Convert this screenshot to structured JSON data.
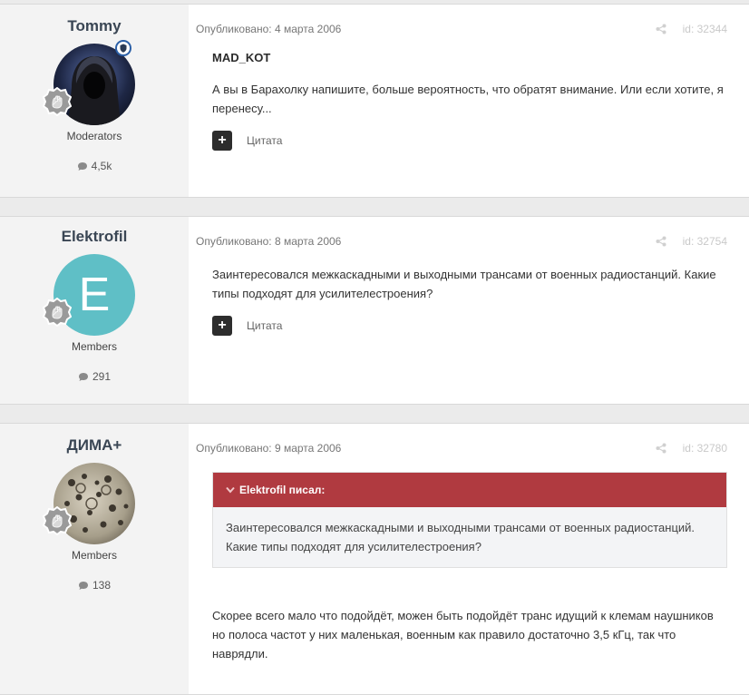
{
  "quote_label": "Цитата",
  "posts": [
    {
      "author": "Tommy",
      "group": "Moderators",
      "post_count": "4,5k",
      "date": "Опубликовано: 4 марта 2006",
      "post_id": "id: 32344",
      "addressee": "MAD_KOT",
      "body": "А вы в Барахолку напишите, больше вероятность, что обратят внимание. Или если хотите, я перенесу..."
    },
    {
      "author": "Elektrofil",
      "group": "Members",
      "post_count": "291",
      "avatar_letter": "E",
      "date": "Опубликовано: 8 марта 2006",
      "post_id": "id: 32754",
      "body": "Заинтересовался межкаскадными и выходными трансами от военных радиостанций. Какие типы подходят для усилителестроения?"
    },
    {
      "author": "ДИМА+",
      "group": "Members",
      "post_count": "138",
      "date": "Опубликовано: 9 марта 2006",
      "post_id": "id: 32780",
      "quote": {
        "header": "Elektrofil писал:",
        "text": "Заинтересовался межкаскадными и выходными трансами от военных радиостанций. Какие типы подходят для усилителестроения?"
      },
      "body": "Скорее всего мало что подойдёт, можен быть подойдёт транс идущий к клемам наушников но полоса частот у них маленькая, военным как правило достаточно 3,5 кГц, так что наврядли."
    }
  ],
  "colors": {
    "accent_quote_header": "#b03a40",
    "avatar_e": "#5fbfc6",
    "page_bg": "#ebebeb"
  },
  "icons": [
    "share-icon",
    "speech-bubble-icon",
    "rank-badge-icon",
    "moderator-shield-icon",
    "chevron-down-icon",
    "plus-icon"
  ]
}
